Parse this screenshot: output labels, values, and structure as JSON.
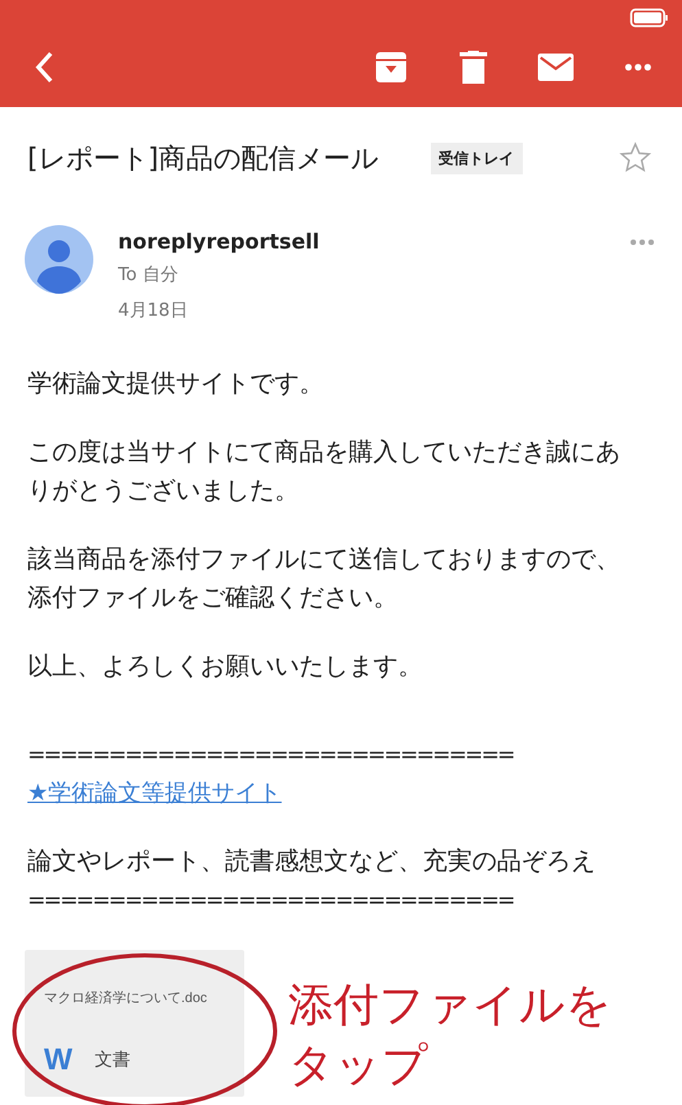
{
  "message": {
    "subject": "[レポート]商品の配信メール",
    "label": "受信トレイ",
    "starred": false,
    "sender": {
      "name": "noreplyreportsell",
      "to": "To 自分",
      "date": "4月18日"
    },
    "body": [
      {
        "lines": [
          {
            "kind": "text",
            "text": "学術論文提供サイトです。"
          }
        ]
      },
      {
        "lines": [
          {
            "kind": "text",
            "text": "この度は当サイトにて商品を購入していただき誠にありがとうございました。"
          }
        ]
      },
      {
        "lines": [
          {
            "kind": "text",
            "text": "該当商品を添付ファイルにて送信しておりますので、"
          },
          {
            "kind": "text",
            "text": "添付ファイルをご確認ください。"
          }
        ]
      },
      {
        "lines": [
          {
            "kind": "text",
            "text": "以上、よろしくお願いいたします。"
          }
        ]
      }
    ],
    "signature": [
      {
        "lines": [
          {
            "kind": "separator",
            "text": "=============================="
          },
          {
            "kind": "link",
            "text": "★学術論文等提供サイト"
          }
        ]
      },
      {
        "lines": [
          {
            "kind": "text",
            "text": "論文やレポート、読書感想文など、充実の品ぞろえ"
          },
          {
            "kind": "separator",
            "text": "=============================="
          }
        ]
      }
    ],
    "attachment": {
      "filename": "マクロ経済学について.doc",
      "icon_letter": "W",
      "type": "文書"
    }
  },
  "annotation": {
    "lines": [
      "添付ファイルを",
      "タップ"
    ]
  }
}
